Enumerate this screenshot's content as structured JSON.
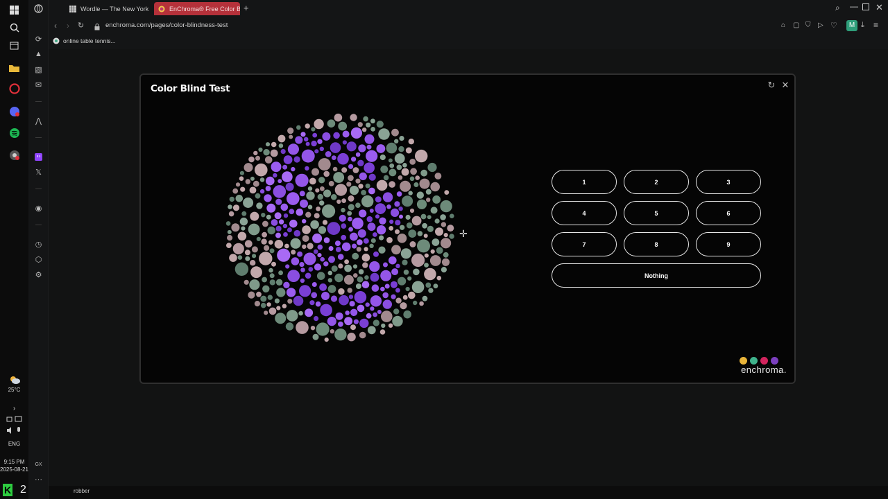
{
  "taskbar": {
    "weather": {
      "temp": "25°C",
      "icon": "weather-cloud-sun-icon"
    },
    "language": "ENG",
    "time": "9:15 PM",
    "date": "2025-08-21",
    "badge": "2",
    "music": "robber"
  },
  "tabs": [
    {
      "label": "Wordle — The New York Times"
    },
    {
      "label": "EnChroma® Free Color Blindness Test"
    }
  ],
  "address": {
    "url": "enchroma.com/pages/color-blindness-test"
  },
  "bookmarks": [
    {
      "label": "online table tennis..."
    }
  ],
  "modal": {
    "title": "Color Blind Test",
    "answers": [
      "1",
      "2",
      "3",
      "4",
      "5",
      "6",
      "7",
      "8",
      "9"
    ],
    "nothing_label": "Nothing",
    "logo_text": "enchroma.",
    "logo_dots": [
      "#e9b53a",
      "#3fb38c",
      "#d2245d",
      "#7b3fbf"
    ]
  },
  "colors": {
    "accent_tab": "#b5313a",
    "plate_background": [
      "#7f9a8a",
      "#6d8b7a",
      "#a28a8e",
      "#b59aa0",
      "#8aa395",
      "#c2a8ab",
      "#5f7d6e"
    ],
    "plate_figure": [
      "#8a4ee0",
      "#9b5cf0",
      "#7a3fd6",
      "#a86af5",
      "#6f39c8",
      "#9456e8"
    ]
  }
}
